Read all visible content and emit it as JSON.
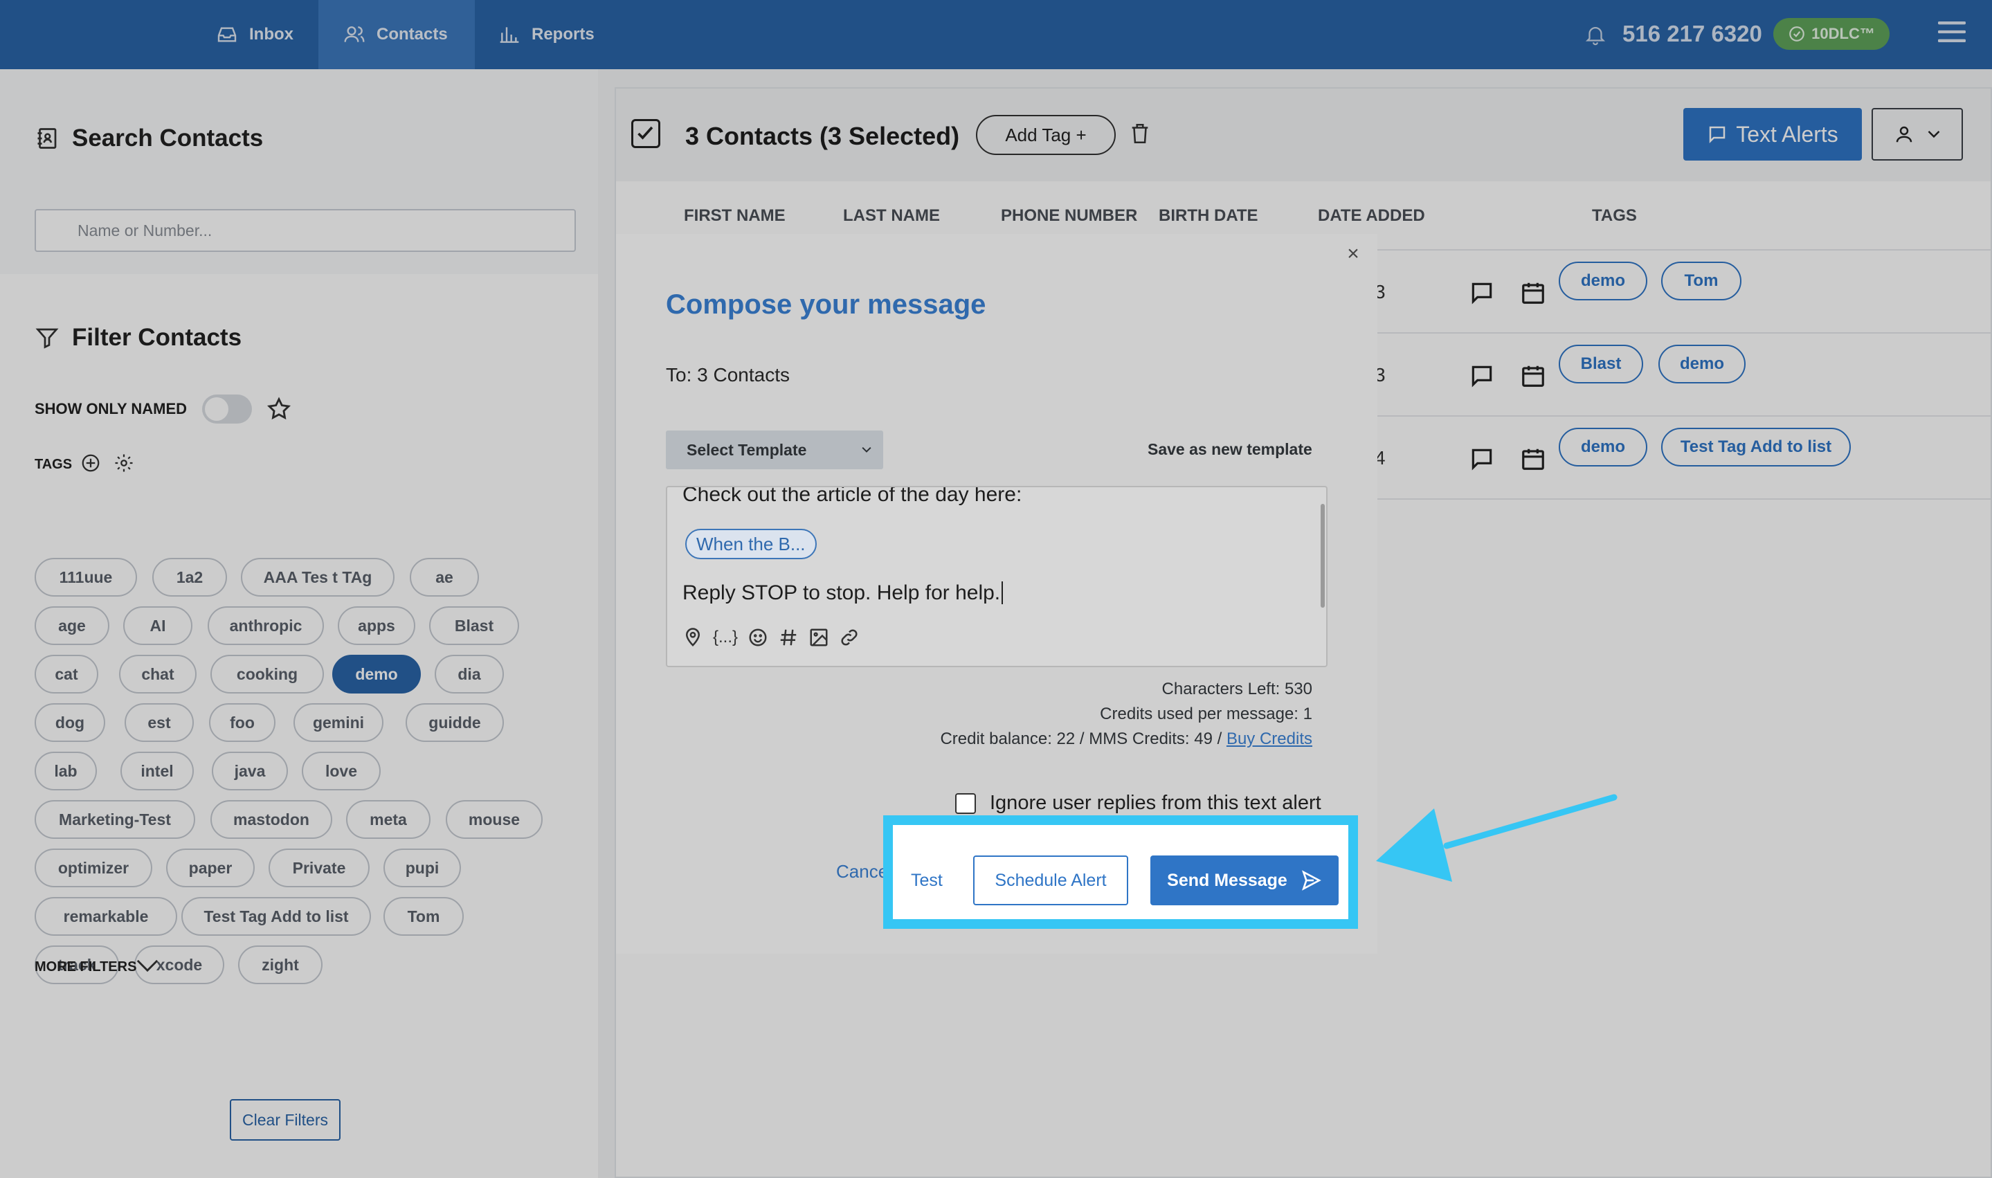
{
  "nav": {
    "tabs": [
      {
        "label": "Inbox",
        "icon": "inbox-icon"
      },
      {
        "label": "Contacts",
        "icon": "users-icon",
        "active": true
      },
      {
        "label": "Reports",
        "icon": "bar-chart-icon"
      }
    ],
    "phone": "516 217 6320",
    "badge": "10DLC™"
  },
  "search": {
    "title": "Search Contacts",
    "placeholder": "Name or Number..."
  },
  "filter": {
    "title": "Filter Contacts",
    "show_only_named": "SHOW ONLY NAMED",
    "tags_label": "TAGS",
    "tags": [
      "111uue",
      "1a2",
      "AAA Tes t TAg",
      "ae",
      "age",
      "AI",
      "anthropic",
      "apps",
      "Blast",
      "cat",
      "chat",
      "cooking",
      "demo",
      "dia",
      "dog",
      "est",
      "foo",
      "gemini",
      "guidde",
      "lab",
      "intel",
      "java",
      "love",
      "Marketing-Test",
      "mastodon",
      "meta",
      "mouse",
      "optimizer",
      "paper",
      "Private",
      "pupi",
      "remarkable",
      "Test Tag Add to list",
      "Tom",
      "track",
      "xcode",
      "zight"
    ],
    "selected_tag": "demo",
    "more_filters": "MORE FILTERS",
    "clear_filters": "Clear Filters"
  },
  "contacts": {
    "title": "3 Contacts (3 Selected)",
    "add_tag": "Add Tag +",
    "text_alerts": "Text Alerts",
    "columns": [
      "FIRST NAME",
      "LAST NAME",
      "PHONE NUMBER",
      "BIRTH DATE",
      "DATE ADDED",
      "TAGS"
    ],
    "rows": [
      {
        "date_fragment": "3",
        "tags": [
          "demo",
          "Tom"
        ]
      },
      {
        "date_fragment": "3",
        "tags": [
          "Blast",
          "demo"
        ]
      },
      {
        "date_fragment": "4",
        "tags": [
          "demo",
          "Test Tag Add to list"
        ]
      }
    ]
  },
  "modal": {
    "close": "×",
    "title": "Compose your message",
    "to": "To: 3 Contacts",
    "template_select": "Select Template",
    "save_template": "Save as new template",
    "body_line1": "Check out the article of the day here:",
    "link_chip": "When the B...",
    "body_line3": "Reply STOP to stop. Help for help.",
    "variable_token": "{...}",
    "chars_left": "Characters Left: 530",
    "credits_per_msg": "Credits used per message: 1",
    "credit_balance": "Credit balance: 22 / MMS Credits: 49 / ",
    "buy_credits": "Buy Credits",
    "ignore_replies": "Ignore user replies from this text alert",
    "cancel": "Cance",
    "test": "Test",
    "schedule": "Schedule Alert",
    "send": "Send Message"
  },
  "colors": {
    "nav_bg": "#2a64a8",
    "primary": "#2f75c6",
    "highlight": "#36c6f4",
    "badge_green": "#5fa35a"
  }
}
